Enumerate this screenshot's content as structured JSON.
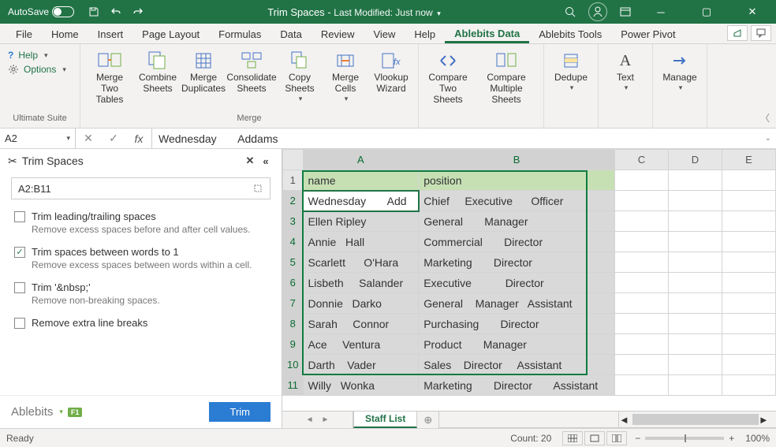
{
  "titlebar": {
    "autosave": "AutoSave",
    "autosave_state": "On",
    "doc_title": "Trim Spaces",
    "modified": "Last Modified: Just now"
  },
  "tabs": [
    "File",
    "Home",
    "Insert",
    "Page Layout",
    "Formulas",
    "Data",
    "Review",
    "View",
    "Help",
    "Ablebits Data",
    "Ablebits Tools",
    "Power Pivot"
  ],
  "active_tab_index": 9,
  "ribbon": {
    "help_label": "Help",
    "options_label": "Options",
    "group1_label": "Ultimate Suite",
    "merge_two_tables": "Merge\nTwo Tables",
    "combine_sheets": "Combine\nSheets",
    "merge_duplicates": "Merge\nDuplicates",
    "consolidate_sheets": "Consolidate\nSheets",
    "copy_sheets": "Copy\nSheets",
    "merge_cells": "Merge\nCells",
    "vlookup_wizard": "Vlookup\nWizard",
    "group2_label": "Merge",
    "compare_two_sheets": "Compare\nTwo Sheets",
    "compare_multi_sheets": "Compare\nMultiple Sheets",
    "dedupe": "Dedupe",
    "text": "Text",
    "manage": "Manage"
  },
  "namebox": "A2",
  "formula": "Wednesday       Addams",
  "pane": {
    "title": "Trim Spaces",
    "range": "A2:B11",
    "opt1": {
      "label": "Trim leading/trailing spaces",
      "desc": "Remove excess spaces before and after cell values.",
      "checked": false
    },
    "opt2": {
      "label": "Trim spaces between words to 1",
      "desc": "Remove excess spaces between words within a cell.",
      "checked": true
    },
    "opt3": {
      "label": "Trim '&nbsp;'",
      "desc": "Remove non-breaking spaces.",
      "checked": false
    },
    "opt4": {
      "label": "Remove extra line breaks",
      "desc": "",
      "checked": false
    },
    "brand": "Ablebits",
    "f1": "F1",
    "trim_btn": "Trim"
  },
  "grid": {
    "columns": [
      "A",
      "B",
      "C",
      "D",
      "E"
    ],
    "headers": {
      "A": "name",
      "B": "position"
    },
    "rows": [
      {
        "n": 2,
        "A": "Wednesday       Add",
        "B": "Chief     Executive      Officer"
      },
      {
        "n": 3,
        "A": "Ellen Ripley",
        "B": "General       Manager"
      },
      {
        "n": 4,
        "A": "Annie   Hall",
        "B": "Commercial       Director"
      },
      {
        "n": 5,
        "A": "Scarlett      O'Hara",
        "B": "Marketing       Director"
      },
      {
        "n": 6,
        "A": "Lisbeth     Salander",
        "B": "Executive           Director"
      },
      {
        "n": 7,
        "A": "Donnie   Darko",
        "B": "General    Manager   Assistant"
      },
      {
        "n": 8,
        "A": "Sarah     Connor",
        "B": "Purchasing       Director"
      },
      {
        "n": 9,
        "A": "Ace     Ventura",
        "B": "Product       Manager"
      },
      {
        "n": 10,
        "A": "Darth    Vader",
        "B": "Sales    Director     Assistant"
      },
      {
        "n": 11,
        "A": "Willy   Wonka",
        "B": "Marketing       Director       Assistant"
      }
    ]
  },
  "sheet_tab": "Staff List",
  "statusbar": {
    "ready": "Ready",
    "count": "Count: 20",
    "zoom": "100%"
  }
}
